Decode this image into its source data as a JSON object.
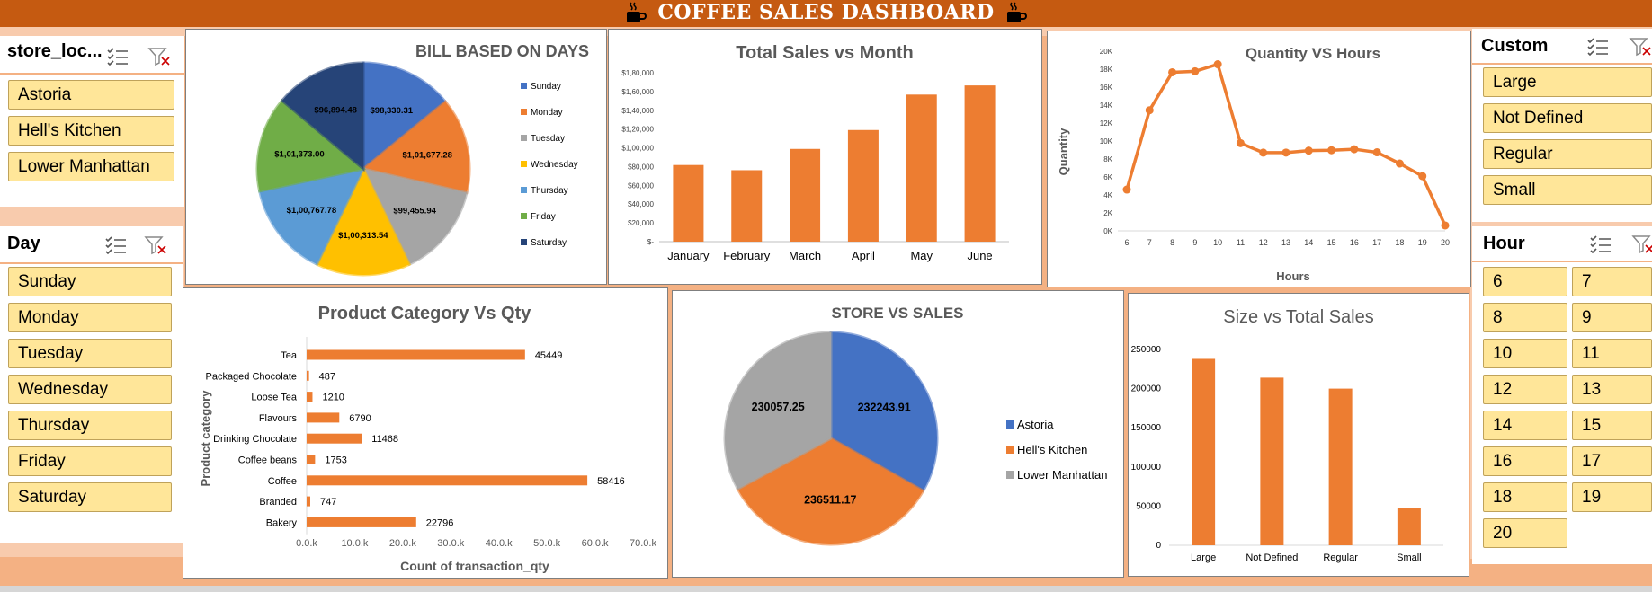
{
  "dashboard": {
    "title": "COFFEE SALES DASHBOARD"
  },
  "slicers": {
    "store": {
      "title": "store_loc...",
      "items": [
        "Astoria",
        "Hell's Kitchen",
        "Lower Manhattan"
      ]
    },
    "day": {
      "title": "Day",
      "items": [
        "Sunday",
        "Monday",
        "Tuesday",
        "Wednesday",
        "Thursday",
        "Friday",
        "Saturday"
      ]
    },
    "custom": {
      "title": "Custom",
      "items": [
        "Large",
        "Not Defined",
        "Regular",
        "Small"
      ]
    },
    "hour": {
      "title": "Hour",
      "items": [
        "6",
        "7",
        "8",
        "9",
        "10",
        "11",
        "12",
        "13",
        "14",
        "15",
        "16",
        "17",
        "18",
        "19",
        "20"
      ]
    }
  },
  "chart_data": [
    {
      "id": "bill",
      "type": "pie",
      "title": "BILL BASED ON DAYS",
      "labels": [
        "Sunday",
        "Monday",
        "Tuesday",
        "Wednesday",
        "Thursday",
        "Friday",
        "Saturday"
      ],
      "values": [
        98330.31,
        101677.28,
        99455.94,
        100313.54,
        100767.78,
        101373.0,
        96894.48
      ],
      "data_labels": [
        "$98,330.31",
        "$1,01,677.28",
        "$99,455.94",
        "$1,00,313.54",
        "$1,00,767.78",
        "$1,01,373.00",
        "$96,894.48"
      ],
      "colors": [
        "#4472c4",
        "#ed7d31",
        "#a5a5a5",
        "#ffc000",
        "#5b9bd5",
        "#70ad47",
        "#264478"
      ],
      "legend": "right"
    },
    {
      "id": "month",
      "type": "bar",
      "title": "Total Sales vs Month",
      "categories": [
        "January",
        "February",
        "March",
        "April",
        "May",
        "June"
      ],
      "values": [
        81677,
        76145,
        98835,
        118941,
        156728,
        166486
      ],
      "yticks": [
        "$-",
        "$20,000",
        "$40,000",
        "$60,000",
        "$80,000",
        "$1,00,000",
        "$1,20,000",
        "$1,40,000",
        "$1,60,000",
        "$1,80,000"
      ],
      "ylim": [
        0,
        180000
      ],
      "color": "#ed7d31"
    },
    {
      "id": "hours",
      "type": "line",
      "title": "Quantity VS Hours",
      "xlabel": "Hours",
      "ylabel": "Quantity",
      "x": [
        6,
        7,
        8,
        9,
        10,
        11,
        12,
        13,
        14,
        15,
        16,
        17,
        18,
        19,
        20
      ],
      "y": [
        4594,
        13428,
        17654,
        17764,
        18545,
        9766,
        8708,
        8714,
        8933,
        8979,
        9093,
        8745,
        7498,
        6092,
        603
      ],
      "yticks": [
        "0K",
        "2K",
        "4K",
        "6K",
        "8K",
        "10K",
        "12K",
        "14K",
        "16K",
        "18K",
        "20K"
      ],
      "ylim": [
        0,
        20000
      ],
      "color": "#ed7d31"
    },
    {
      "id": "category",
      "type": "bar",
      "orientation": "horizontal",
      "title": "Product Category Vs Qty",
      "xlabel": "Count of transaction_qty",
      "ylabel": "Product category",
      "categories": [
        "Tea",
        "Packaged Chocolate",
        "Loose Tea",
        "Flavours",
        "Drinking Chocolate",
        "Coffee beans",
        "Coffee",
        "Branded",
        "Bakery"
      ],
      "values": [
        45449,
        487,
        1210,
        6790,
        11468,
        1753,
        58416,
        747,
        22796
      ],
      "xticks": [
        "0.0.k",
        "10.0.k",
        "20.0.k",
        "30.0.k",
        "40.0.k",
        "50.0.k",
        "60.0.k",
        "70.0.k"
      ],
      "xlim": [
        0,
        70000
      ],
      "color": "#ed7d31"
    },
    {
      "id": "store",
      "type": "pie",
      "title": "STORE VS SALES",
      "labels": [
        "Astoria",
        "Hell's Kitchen",
        "Lower Manhattan"
      ],
      "values": [
        232243.91,
        236511.17,
        230057.25
      ],
      "data_labels": [
        "232243.91",
        "236511.17",
        "230057.25"
      ],
      "colors": [
        "#4472c4",
        "#ed7d31",
        "#a5a5a5"
      ],
      "legend": "right"
    },
    {
      "id": "size",
      "type": "bar",
      "title": "Size vs Total Sales",
      "categories": [
        "Large",
        "Not Defined",
        "Regular",
        "Small"
      ],
      "values": [
        238000,
        214000,
        200000,
        47000
      ],
      "yticks": [
        "0",
        "50000",
        "100000",
        "150000",
        "200000",
        "250000"
      ],
      "ylim": [
        0,
        250000
      ],
      "color": "#ed7d31"
    }
  ]
}
